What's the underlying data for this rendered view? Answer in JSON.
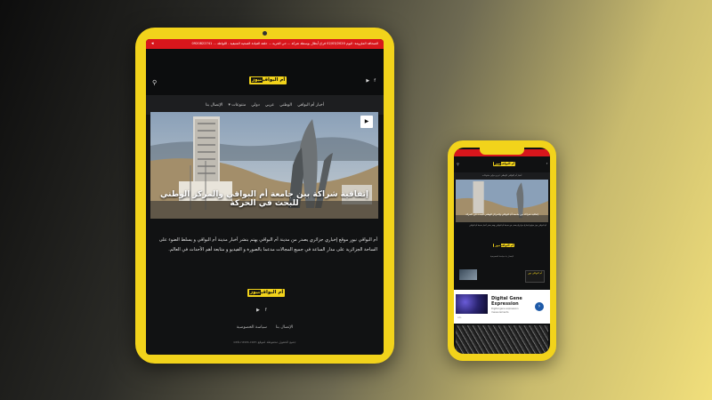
{
  "tablet": {
    "ticker_text": "الصحافة الملزومة: اليوم 02/03/2020 فراخ أبطال بوسطة شركة ... حي الحرية ... حلقة القيادة الصحية المتبقية - اللواظة ... 0920822741",
    "logo_text": "أم البواقي",
    "logo_tag": "نيوز",
    "nav": [
      "أخبار أم البواقي",
      "الوطني",
      "عربي",
      "دولي",
      "متنوعات ▾",
      "الإتصال بنا"
    ],
    "hero_headline": "إتفاقية شراكة بين جامعة أم البواقي والمركز الوطني للبحث في الحركة",
    "description": "أم البواقي نيوز موقع إخباري جزائري يصدر من مدينة أم البواقي يهتم بنشر أخبار مدينة أم البواقي و يسلط الضوء على الساحة الجزائرية على مدار الساعة في جميع المجالات مدعما بالصورة و الفيديو و متابعة أهم الأحداث في العالم.",
    "footer_links": [
      "الإتصال بنا",
      "سياسة الخصوصية"
    ],
    "copyright": "جميع الحقوق محفوظة لموقع oeb-news.com"
  },
  "phone": {
    "hero_title": "إتفاقية شراكة بين جامعة أم البواقي والمركز الوطني للبحث في الحركة",
    "nav_text": "أخبار أم البواقي الوطني عربي دولي متنوعات",
    "description": "أم البواقي نيوز موقع إخباري جزائري يصدر من مدينة أم البواقي يهتم بنشر أخبار مدينة أم البواقي",
    "links": "الإتصال بنا  سياسة الخصوصية",
    "promo": "أم البواقي نيوز",
    "ad": {
      "title": "Digital Gene Expression",
      "subtitle": "Digital gene expression measurements",
      "tag": "Ads"
    }
  },
  "colors": {
    "accent": "#f2d31b",
    "ticker": "#d8161c",
    "screen_bg": "#111213"
  },
  "icons": [
    "search-icon",
    "youtube-icon",
    "facebook-icon",
    "play-icon",
    "arrow-right-icon"
  ]
}
